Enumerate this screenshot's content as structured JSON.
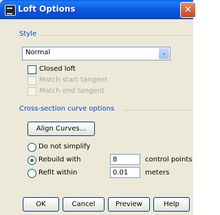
{
  "window": {
    "title": "Loft Options",
    "close_glyph": "✕"
  },
  "style_group": {
    "label": "Style",
    "select_value": "Normal",
    "checkboxes": [
      {
        "label": "Closed loft",
        "checked": false,
        "disabled": false
      },
      {
        "label": "Match start tangent",
        "checked": false,
        "disabled": true
      },
      {
        "label": "Match end tangent",
        "checked": false,
        "disabled": true
      }
    ]
  },
  "cross_section_group": {
    "label": "Cross-section curve options",
    "align_button": "Align Curves...",
    "radios": [
      {
        "label": "Do not simplify",
        "selected": false
      },
      {
        "label": "Rebuild with",
        "selected": true,
        "value": "8",
        "unit": "control points"
      },
      {
        "label": "Refit within",
        "selected": false,
        "value": "0.01",
        "unit": "meters"
      }
    ]
  },
  "buttons": {
    "ok": "OK",
    "cancel": "Cancel",
    "preview": "Preview",
    "help": "Help"
  },
  "colors": {
    "accent": "#0046d5",
    "titlebar": "#0a55df",
    "dialog_bg": "#ece9d8"
  }
}
